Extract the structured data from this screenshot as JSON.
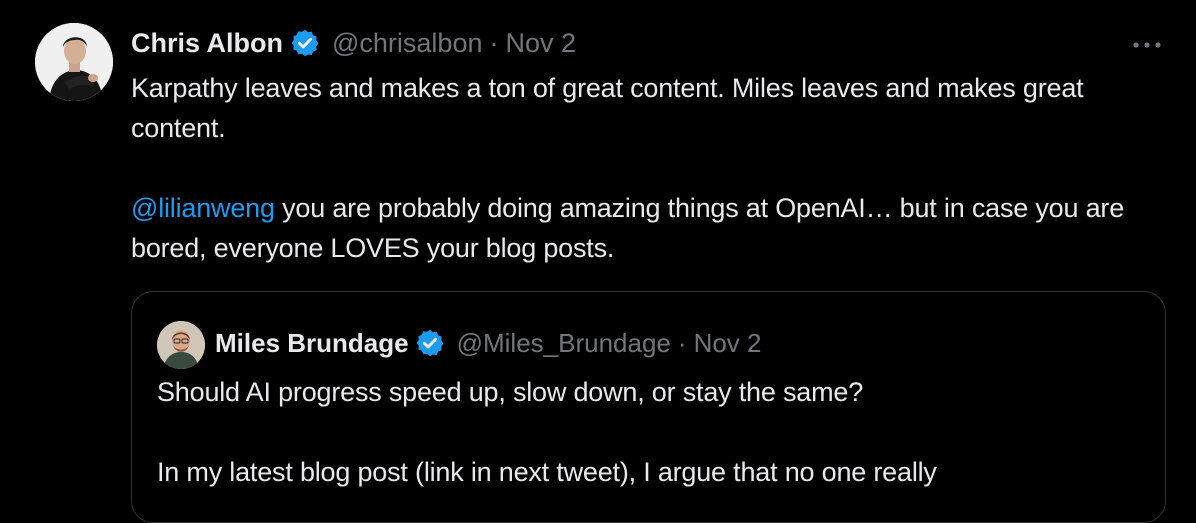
{
  "tweet": {
    "author": {
      "name": "Chris Albon",
      "handle": "@chrisalbon",
      "separator": "·",
      "date": "Nov 2",
      "verified_color": "#1d9bf0"
    },
    "text": {
      "line1": "Karpathy leaves and makes a ton of great content. Miles leaves and makes great content.",
      "mention": "@lilianweng",
      "line2_rest": " you are probably doing amazing things at OpenAI… but in case you are bored, everyone LOVES your blog posts."
    },
    "more_icon": "more-horizontal-icon"
  },
  "quote": {
    "author": {
      "name": "Miles Brundage",
      "handle": "@Miles_Brundage",
      "separator": "·",
      "date": "Nov 2"
    },
    "text": {
      "line1": "Should AI progress speed up, slow down, or stay the same?",
      "line2": "In my latest blog post (link in next tweet), I argue that no one really"
    }
  },
  "colors": {
    "background": "#000000",
    "text": "#e7e9ea",
    "secondary": "#71767b",
    "link": "#1d9bf0",
    "border": "#2f3336"
  }
}
